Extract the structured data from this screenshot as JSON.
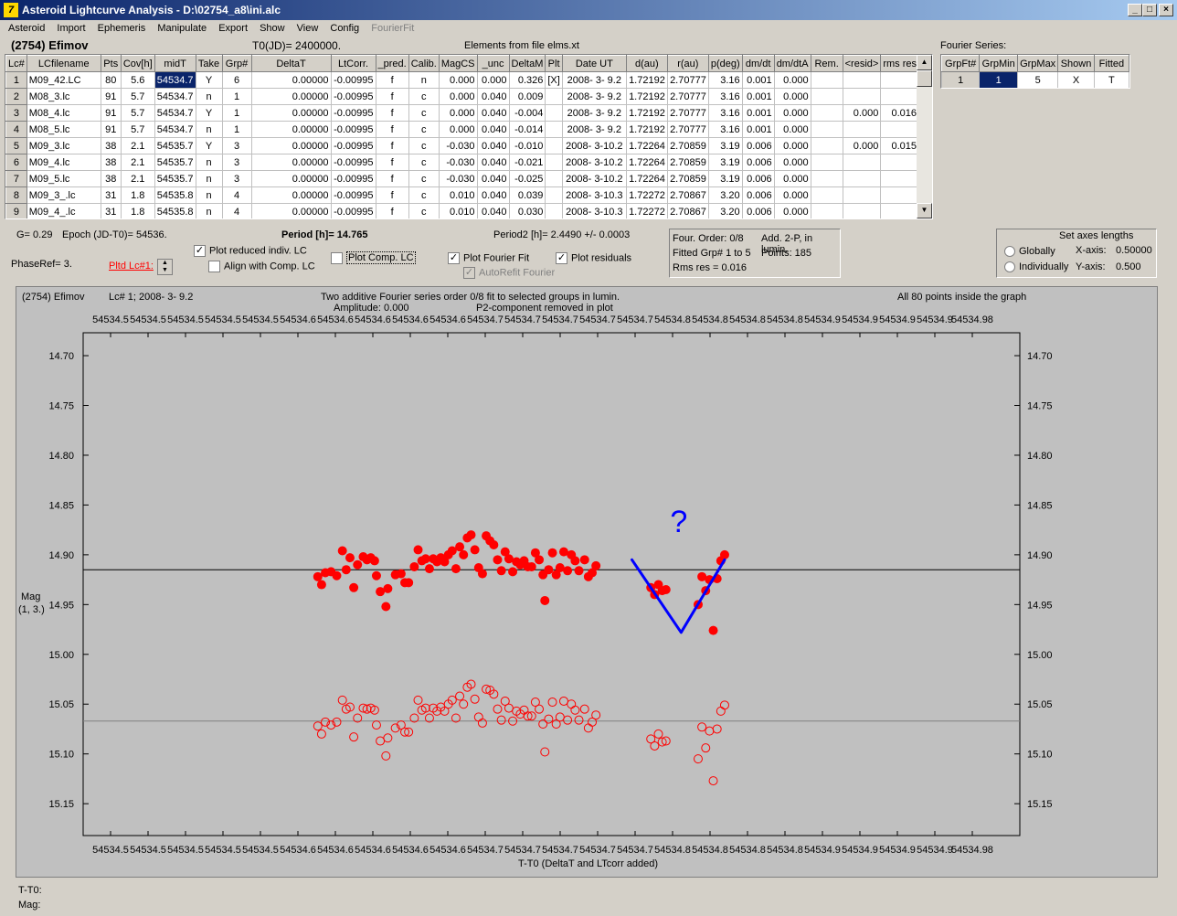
{
  "window": {
    "title": "Asteroid Lightcurve Analysis - D:\\02754_a8\\ini.alc",
    "min_glyph": "_",
    "max_glyph": "□",
    "close_glyph": "×"
  },
  "menu": [
    "Asteroid",
    "Import",
    "Ephemeris",
    "Manipulate",
    "Export",
    "Show",
    "View",
    "Config",
    "FourierFit"
  ],
  "header": {
    "asteroid": "(2754) Efimov",
    "t0": "T0(JD)= 2400000.",
    "elements": "Elements from file elms.xt"
  },
  "table": {
    "columns": [
      "Lc#",
      "LCfilename",
      "Pts",
      "Cov[h]",
      "midT",
      "Take",
      "Grp#",
      "DeltaT",
      "LtCorr.",
      "_pred.",
      "Calib.",
      "MagCS",
      "_unc",
      "DeltaM",
      "Plt",
      "Date UT",
      "d(au)",
      "r(au)",
      "p(deg)",
      "dm/dt",
      "dm/dtA",
      "Rem.",
      "<resid>",
      "rms res"
    ],
    "rows": [
      [
        "1",
        "M09_42.LC",
        "80",
        "5.6",
        "54534.7",
        "Y",
        "6",
        "0.00000",
        "-0.00995",
        "f",
        "n",
        "0.000",
        "0.000",
        "0.326",
        "[X]",
        "2008- 3- 9.2",
        "1.72192",
        "2.70777",
        "3.16",
        "0.001",
        "0.000",
        "",
        "",
        ""
      ],
      [
        "2",
        "M08_3.lc",
        "91",
        "5.7",
        "54534.7",
        "n",
        "1",
        "0.00000",
        "-0.00995",
        "f",
        "c",
        "0.000",
        "0.040",
        "0.009",
        "",
        "2008- 3- 9.2",
        "1.72192",
        "2.70777",
        "3.16",
        "0.001",
        "0.000",
        "",
        "",
        ""
      ],
      [
        "3",
        "M08_4.lc",
        "91",
        "5.7",
        "54534.7",
        "Y",
        "1",
        "0.00000",
        "-0.00995",
        "f",
        "c",
        "0.000",
        "0.040",
        "-0.004",
        "",
        "2008- 3- 9.2",
        "1.72192",
        "2.70777",
        "3.16",
        "0.001",
        "0.000",
        "",
        "0.000",
        "0.016"
      ],
      [
        "4",
        "M08_5.lc",
        "91",
        "5.7",
        "54534.7",
        "n",
        "1",
        "0.00000",
        "-0.00995",
        "f",
        "c",
        "0.000",
        "0.040",
        "-0.014",
        "",
        "2008- 3- 9.2",
        "1.72192",
        "2.70777",
        "3.16",
        "0.001",
        "0.000",
        "",
        "",
        ""
      ],
      [
        "5",
        "M09_3.lc",
        "38",
        "2.1",
        "54535.7",
        "Y",
        "3",
        "0.00000",
        "-0.00995",
        "f",
        "c",
        "-0.030",
        "0.040",
        "-0.010",
        "",
        "2008- 3-10.2",
        "1.72264",
        "2.70859",
        "3.19",
        "0.006",
        "0.000",
        "",
        "0.000",
        "0.015"
      ],
      [
        "6",
        "M09_4.lc",
        "38",
        "2.1",
        "54535.7",
        "n",
        "3",
        "0.00000",
        "-0.00995",
        "f",
        "c",
        "-0.030",
        "0.040",
        "-0.021",
        "",
        "2008- 3-10.2",
        "1.72264",
        "2.70859",
        "3.19",
        "0.006",
        "0.000",
        "",
        "",
        ""
      ],
      [
        "7",
        "M09_5.lc",
        "38",
        "2.1",
        "54535.7",
        "n",
        "3",
        "0.00000",
        "-0.00995",
        "f",
        "c",
        "-0.030",
        "0.040",
        "-0.025",
        "",
        "2008- 3-10.2",
        "1.72264",
        "2.70859",
        "3.19",
        "0.006",
        "0.000",
        "",
        "",
        ""
      ],
      [
        "8",
        "M09_3_.lc",
        "31",
        "1.8",
        "54535.8",
        "n",
        "4",
        "0.00000",
        "-0.00995",
        "f",
        "c",
        "0.010",
        "0.040",
        "0.039",
        "",
        "2008- 3-10.3",
        "1.72272",
        "2.70867",
        "3.20",
        "0.006",
        "0.000",
        "",
        "",
        ""
      ],
      [
        "9",
        "M09_4_.lc",
        "31",
        "1.8",
        "54535.8",
        "n",
        "4",
        "0.00000",
        "-0.00995",
        "f",
        "c",
        "0.010",
        "0.040",
        "0.030",
        "",
        "2008- 3-10.3",
        "1.72272",
        "2.70867",
        "3.20",
        "0.006",
        "0.000",
        "",
        "",
        ""
      ]
    ]
  },
  "fourier_table": {
    "title": "Fourier Series:",
    "columns": [
      "GrpFt#",
      "GrpMin",
      "GrpMax",
      "Shown",
      "Fitted"
    ],
    "row": [
      "1",
      "1",
      "5",
      "X",
      "T"
    ]
  },
  "controls": {
    "g": "G= 0.29",
    "epoch": "Epoch (JD-T0)= 54536.",
    "period": "Period [h]= 14.765",
    "period2": "Period2 [h]= 2.4490 +/- 0.0003",
    "phaseref": "PhaseRef= 3.",
    "pltd_lc": "Pltd Lc#1:",
    "plot_reduced": "Plot reduced indiv. LC",
    "align_comp": "Align with Comp. LC",
    "plot_comp": "Plot Comp. LC",
    "plot_fourier": "Plot Fourier Fit",
    "autorefit": "AutoRefit Fourier",
    "plot_residuals": "Plot residuals",
    "check_glyph": "✓"
  },
  "info": {
    "four_order": "Four. Order:  0/8",
    "add_2p": "Add. 2-P, in lumin.",
    "fitted_grp": "Fitted Grp# 1 to 5",
    "points": "Points: 185",
    "rms": "Rms res     = 0.016"
  },
  "axes_box": {
    "title": "Set axes lengths",
    "globally": "Globally",
    "individually": "Individually",
    "x_label": "X-axis:",
    "x_value": "0.50000",
    "y_label": "Y-axis:",
    "y_value": "0.500"
  },
  "plot_header": {
    "object": "(2754) Efimov",
    "lc_info": "Lc# 1; 2008- 3- 9.2",
    "fit_line": "Two additive Fourier series order 0/8 fit to selected groups in lumin.",
    "amplitude": "Amplitude: 0.000",
    "p2_line": "P2-component removed in plot",
    "points_inside": "All 80 points inside the graph",
    "y_label_1": "Mag",
    "y_label_2": "(1, 3.)",
    "x_label": "T-T0 (DeltaT and LTcorr added)",
    "annotation": "?"
  },
  "status": {
    "t_t0": "T-T0:",
    "mag": "Mag:"
  },
  "chart_data": {
    "type": "scatter",
    "x_tick_labels_top": [
      "54534.5",
      "54534.5",
      "54534.5",
      "54534.5",
      "54534.5",
      "54534.6",
      "54534.6",
      "54534.6",
      "54534.6",
      "54534.6",
      "54534.7",
      "54534.7",
      "54534.7",
      "54534.7",
      "54534.7",
      "54534.8",
      "54534.8",
      "54534.8",
      "54534.8",
      "54534.9",
      "54534.9",
      "54534.9",
      "54534.9",
      "54534.98"
    ],
    "x_tick_labels_bottom": [
      "54534.5",
      "54534.5",
      "54534.5",
      "54534.5",
      "54534.5",
      "54534.6",
      "54534.6",
      "54534.6",
      "54534.6",
      "54534.6",
      "54534.7",
      "54534.7",
      "54534.7",
      "54534.7",
      "54534.7",
      "54534.8",
      "54534.8",
      "54534.8",
      "54534.8",
      "54534.9",
      "54534.9",
      "54534.9",
      "54534.9",
      "54534.98"
    ],
    "xlim": [
      54534.49,
      54534.985
    ],
    "ylim": [
      14.677,
      15.182
    ],
    "y_ticks": [
      14.7,
      14.75,
      14.8,
      14.85,
      14.9,
      14.95,
      15.0,
      15.05,
      15.1,
      15.15
    ],
    "y_tick_labels": [
      "14.70",
      "14.75",
      "14.80",
      "14.85",
      "14.90",
      "14.95",
      "15.00",
      "15.05",
      "15.10",
      "15.15"
    ],
    "fit_line_mag": 14.915,
    "residual_line_mag": 15.067,
    "series": [
      {
        "style": "filled",
        "color": "#ff0000",
        "points": [
          [
            54534.614,
            14.922
          ],
          [
            54534.616,
            14.93
          ],
          [
            54534.618,
            14.918
          ],
          [
            54534.621,
            14.917
          ],
          [
            54534.624,
            14.921
          ],
          [
            54534.627,
            14.896
          ],
          [
            54534.629,
            14.915
          ],
          [
            54534.631,
            14.903
          ],
          [
            54534.633,
            14.933
          ],
          [
            54534.635,
            14.91
          ],
          [
            54534.638,
            14.902
          ],
          [
            54534.64,
            14.905
          ],
          [
            54534.642,
            14.903
          ],
          [
            54534.644,
            14.906
          ],
          [
            54534.645,
            14.921
          ],
          [
            54534.647,
            14.937
          ],
          [
            54534.65,
            14.952
          ],
          [
            54534.651,
            14.934
          ],
          [
            54534.655,
            14.92
          ],
          [
            54534.658,
            14.919
          ],
          [
            54534.66,
            14.928
          ],
          [
            54534.662,
            14.928
          ],
          [
            54534.665,
            14.912
          ],
          [
            54534.667,
            14.895
          ],
          [
            54534.669,
            14.906
          ],
          [
            54534.671,
            14.904
          ],
          [
            54534.673,
            14.914
          ],
          [
            54534.675,
            14.904
          ],
          [
            54534.677,
            14.907
          ],
          [
            54534.679,
            14.903
          ],
          [
            54534.681,
            14.907
          ],
          [
            54534.683,
            14.9
          ],
          [
            54534.685,
            14.896
          ],
          [
            54534.687,
            14.914
          ],
          [
            54534.689,
            14.892
          ],
          [
            54534.691,
            14.9
          ],
          [
            54534.693,
            14.883
          ],
          [
            54534.695,
            14.88
          ],
          [
            54534.697,
            14.895
          ],
          [
            54534.699,
            14.913
          ],
          [
            54534.701,
            14.919
          ],
          [
            54534.703,
            14.881
          ],
          [
            54534.705,
            14.886
          ],
          [
            54534.707,
            14.89
          ],
          [
            54534.709,
            14.905
          ],
          [
            54534.711,
            14.916
          ],
          [
            54534.713,
            14.897
          ],
          [
            54534.715,
            14.904
          ],
          [
            54534.717,
            14.917
          ],
          [
            54534.719,
            14.907
          ],
          [
            54534.721,
            14.91
          ],
          [
            54534.723,
            14.906
          ],
          [
            54534.725,
            14.912
          ],
          [
            54534.727,
            14.912
          ],
          [
            54534.729,
            14.898
          ],
          [
            54534.731,
            14.905
          ],
          [
            54534.733,
            14.92
          ],
          [
            54534.734,
            14.946
          ],
          [
            54534.736,
            14.915
          ],
          [
            54534.738,
            14.898
          ],
          [
            54534.74,
            14.92
          ],
          [
            54534.742,
            14.913
          ],
          [
            54534.744,
            14.897
          ],
          [
            54534.746,
            14.916
          ],
          [
            54534.748,
            14.9
          ],
          [
            54534.75,
            14.906
          ],
          [
            54534.752,
            14.916
          ],
          [
            54534.755,
            14.905
          ],
          [
            54534.757,
            14.922
          ],
          [
            54534.759,
            14.918
          ],
          [
            54534.761,
            14.911
          ],
          [
            54534.79,
            14.933
          ],
          [
            54534.792,
            14.94
          ],
          [
            54534.794,
            14.93
          ],
          [
            54534.796,
            14.936
          ],
          [
            54534.798,
            14.935
          ],
          [
            54534.815,
            14.95
          ],
          [
            54534.817,
            14.922
          ],
          [
            54534.819,
            14.936
          ],
          [
            54534.821,
            14.925
          ],
          [
            54534.823,
            14.976
          ],
          [
            54534.825,
            14.924
          ],
          [
            54534.827,
            14.906
          ],
          [
            54534.829,
            14.9
          ]
        ]
      },
      {
        "style": "open",
        "color": "#ff0000",
        "points": [
          [
            54534.614,
            15.072
          ],
          [
            54534.616,
            15.08
          ],
          [
            54534.618,
            15.068
          ],
          [
            54534.621,
            15.071
          ],
          [
            54534.624,
            15.068
          ],
          [
            54534.627,
            15.046
          ],
          [
            54534.629,
            15.055
          ],
          [
            54534.631,
            15.053
          ],
          [
            54534.633,
            15.083
          ],
          [
            54534.635,
            15.064
          ],
          [
            54534.638,
            15.054
          ],
          [
            54534.64,
            15.055
          ],
          [
            54534.642,
            15.054
          ],
          [
            54534.644,
            15.056
          ],
          [
            54534.645,
            15.071
          ],
          [
            54534.647,
            15.087
          ],
          [
            54534.65,
            15.102
          ],
          [
            54534.651,
            15.084
          ],
          [
            54534.655,
            15.074
          ],
          [
            54534.658,
            15.071
          ],
          [
            54534.66,
            15.078
          ],
          [
            54534.662,
            15.078
          ],
          [
            54534.665,
            15.064
          ],
          [
            54534.667,
            15.046
          ],
          [
            54534.669,
            15.056
          ],
          [
            54534.671,
            15.054
          ],
          [
            54534.673,
            15.064
          ],
          [
            54534.675,
            15.054
          ],
          [
            54534.677,
            15.057
          ],
          [
            54534.679,
            15.053
          ],
          [
            54534.681,
            15.057
          ],
          [
            54534.683,
            15.05
          ],
          [
            54534.685,
            15.046
          ],
          [
            54534.687,
            15.064
          ],
          [
            54534.689,
            15.042
          ],
          [
            54534.691,
            15.05
          ],
          [
            54534.693,
            15.033
          ],
          [
            54534.695,
            15.03
          ],
          [
            54534.697,
            15.045
          ],
          [
            54534.699,
            15.063
          ],
          [
            54534.701,
            15.069
          ],
          [
            54534.703,
            15.035
          ],
          [
            54534.705,
            15.036
          ],
          [
            54534.707,
            15.04
          ],
          [
            54534.709,
            15.055
          ],
          [
            54534.711,
            15.066
          ],
          [
            54534.713,
            15.047
          ],
          [
            54534.715,
            15.054
          ],
          [
            54534.717,
            15.067
          ],
          [
            54534.719,
            15.057
          ],
          [
            54534.721,
            15.06
          ],
          [
            54534.723,
            15.056
          ],
          [
            54534.725,
            15.062
          ],
          [
            54534.727,
            15.062
          ],
          [
            54534.729,
            15.048
          ],
          [
            54534.731,
            15.055
          ],
          [
            54534.733,
            15.07
          ],
          [
            54534.734,
            15.098
          ],
          [
            54534.736,
            15.065
          ],
          [
            54534.738,
            15.048
          ],
          [
            54534.74,
            15.07
          ],
          [
            54534.742,
            15.063
          ],
          [
            54534.744,
            15.047
          ],
          [
            54534.746,
            15.066
          ],
          [
            54534.748,
            15.05
          ],
          [
            54534.75,
            15.056
          ],
          [
            54534.752,
            15.066
          ],
          [
            54534.755,
            15.055
          ],
          [
            54534.757,
            15.074
          ],
          [
            54534.759,
            15.068
          ],
          [
            54534.761,
            15.061
          ],
          [
            54534.79,
            15.085
          ],
          [
            54534.792,
            15.092
          ],
          [
            54534.794,
            15.08
          ],
          [
            54534.796,
            15.088
          ],
          [
            54534.798,
            15.087
          ],
          [
            54534.815,
            15.105
          ],
          [
            54534.817,
            15.073
          ],
          [
            54534.819,
            15.094
          ],
          [
            54534.821,
            15.077
          ],
          [
            54534.823,
            15.127
          ],
          [
            54534.825,
            15.075
          ],
          [
            54534.827,
            15.057
          ],
          [
            54534.829,
            15.051
          ]
        ]
      }
    ],
    "drawn_annotation": {
      "color": "#0000ff",
      "points": [
        [
          54534.78,
          14.905
        ],
        [
          54534.806,
          14.978
        ],
        [
          54534.829,
          14.905
        ]
      ]
    }
  }
}
